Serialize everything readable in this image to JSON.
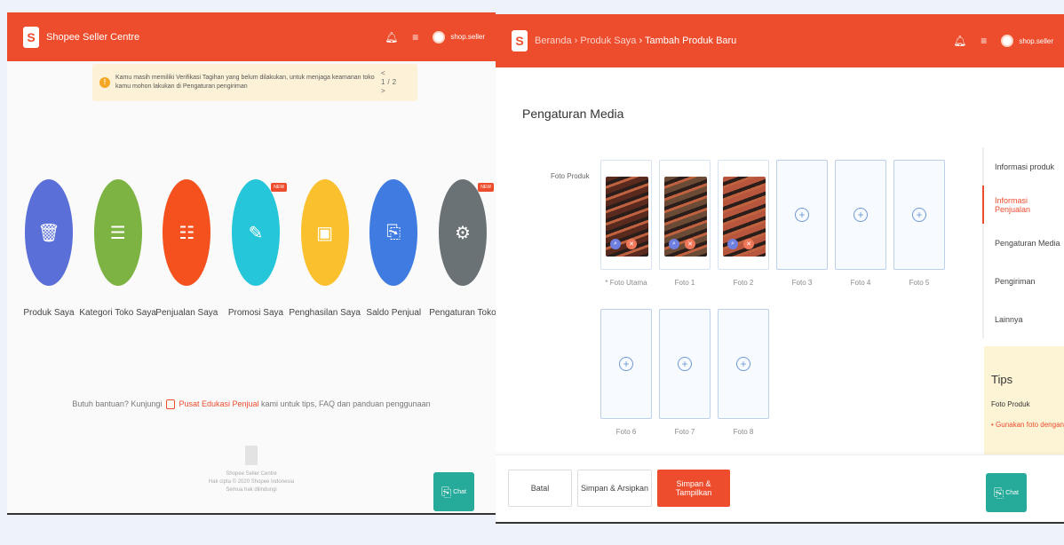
{
  "left": {
    "brand": "Shopee Seller Centre",
    "header": {
      "username": "shop.seller"
    },
    "notice": {
      "text": "Kamu masih memiliki Verifikasi Tagihan yang belum dilakukan, untuk menjaga keamanan toko kamu mohon lakukan di Pengaturan pengiriman",
      "pager": "< 1/2 >"
    },
    "menu": [
      {
        "label": "Produk Saya",
        "color": "#5b6fd8",
        "icon": "trash-icon",
        "glyph": "🗑",
        "badge": ""
      },
      {
        "label": "Kategori Toko Saya",
        "color": "#7cb342",
        "icon": "list-icon",
        "glyph": "☰",
        "badge": ""
      },
      {
        "label": "Penjualan Saya",
        "color": "#f4511e",
        "icon": "clipboard-icon",
        "glyph": "☷",
        "badge": ""
      },
      {
        "label": "Promosi Saya",
        "color": "#26c6da",
        "icon": "pen-icon",
        "glyph": "✎",
        "badge": "NEW"
      },
      {
        "label": "Penghasilan Saya",
        "color": "#fbc02d",
        "icon": "wallet-icon",
        "glyph": "▣",
        "badge": ""
      },
      {
        "label": "Saldo Penjual",
        "color": "#3f7be0",
        "icon": "note-icon",
        "glyph": "⎘",
        "badge": ""
      },
      {
        "label": "Pengaturan Toko",
        "color": "#6b7276",
        "icon": "gear-icon",
        "glyph": "⚙",
        "badge": "NEW"
      }
    ],
    "help": {
      "before": "Butuh bantuan? Kunjungi",
      "link": "Pusat Edukasi Penjual",
      "after": "kami untuk tips, FAQ dan panduan penggunaan"
    },
    "footer": {
      "line1": "Shopee Seller Centre",
      "line2": "Hak cipta © 2020 Shopee Indonesia",
      "line3": "Semua hak dilindungi"
    },
    "chat_label": "Chat"
  },
  "right": {
    "breadcrumb": {
      "home": "Beranda",
      "products": "Produk Saya",
      "current": "Tambah Produk Baru"
    },
    "header": {
      "username": "shop.seller"
    },
    "section_title": "Pengaturan Media",
    "field_label": "Foto Produk",
    "photos": [
      {
        "caption": "* Foto Utama",
        "filled": true,
        "color": "#5a2a1e"
      },
      {
        "caption": "Foto 1",
        "filled": true,
        "color": "#6b4a36"
      },
      {
        "caption": "Foto 2",
        "filled": true,
        "color": "#b7563d"
      },
      {
        "caption": "Foto 3",
        "filled": false
      },
      {
        "caption": "Foto 4",
        "filled": false
      },
      {
        "caption": "Foto 5",
        "filled": false
      },
      {
        "caption": "Foto 6",
        "filled": false
      },
      {
        "caption": "Foto 7",
        "filled": false
      },
      {
        "caption": "Foto 8",
        "filled": false
      }
    ],
    "sidebar": [
      {
        "label": "Informasi produk",
        "active": false
      },
      {
        "label": "Informasi Penjualan",
        "active": true
      },
      {
        "label": "Pengaturan Media",
        "active": false
      },
      {
        "label": "Pengiriman",
        "active": false
      },
      {
        "label": "Lainnya",
        "active": false
      }
    ],
    "tips": {
      "title": "Tips",
      "subtitle": "Foto Produk",
      "text": "• Gunakan foto dengan uk"
    },
    "actions": {
      "back": "Batal",
      "save_hide": "Simpan & Arsipkan",
      "save_show": "Simpan & Tampilkan"
    },
    "chat_label": "Chat"
  }
}
